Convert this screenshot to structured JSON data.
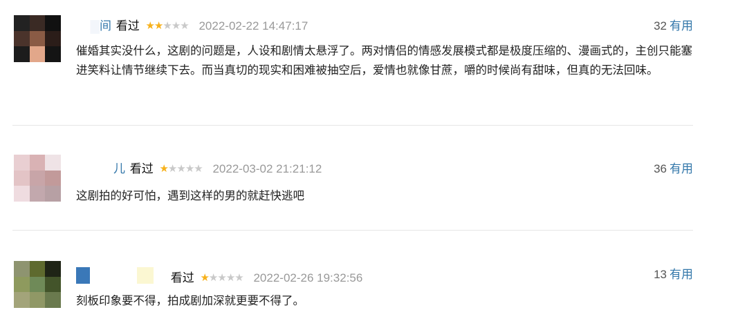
{
  "comments": [
    {
      "username": "间",
      "watched_label": "看过",
      "rating": 2,
      "rating_max": 5,
      "time": "2022-02-22 14:47:17",
      "votes": "32",
      "useful_label": "有用",
      "text": "催婚其实没什么，这剧的问题是，人设和剧情太悬浮了。两对情侣的情感发展模式都是极度压缩的、漫画式的，主创只能塞进笑料让情节继续下去。而当真切的现实和困难被抽空后，爱情也就像甘蔗，嚼的时候尚有甜味，但真的无法回味。"
    },
    {
      "username": "儿",
      "watched_label": "看过",
      "rating": 1,
      "rating_max": 5,
      "time": "2022-03-02 21:21:12",
      "votes": "36",
      "useful_label": "有用",
      "text": "这剧拍的好可怕，遇到这样的男的就赶快逃吧"
    },
    {
      "username": "",
      "watched_label": "看过",
      "rating": 1,
      "rating_max": 5,
      "time": "2022-02-26 19:32:56",
      "votes": "13",
      "useful_label": "有用",
      "text": "刻板印象要不得，拍成剧加深就更要不得了。"
    }
  ],
  "colors": {
    "link": "#3377aa",
    "star_on": "#f7b11b",
    "star_off": "#c9c9c9",
    "time": "#999999"
  }
}
